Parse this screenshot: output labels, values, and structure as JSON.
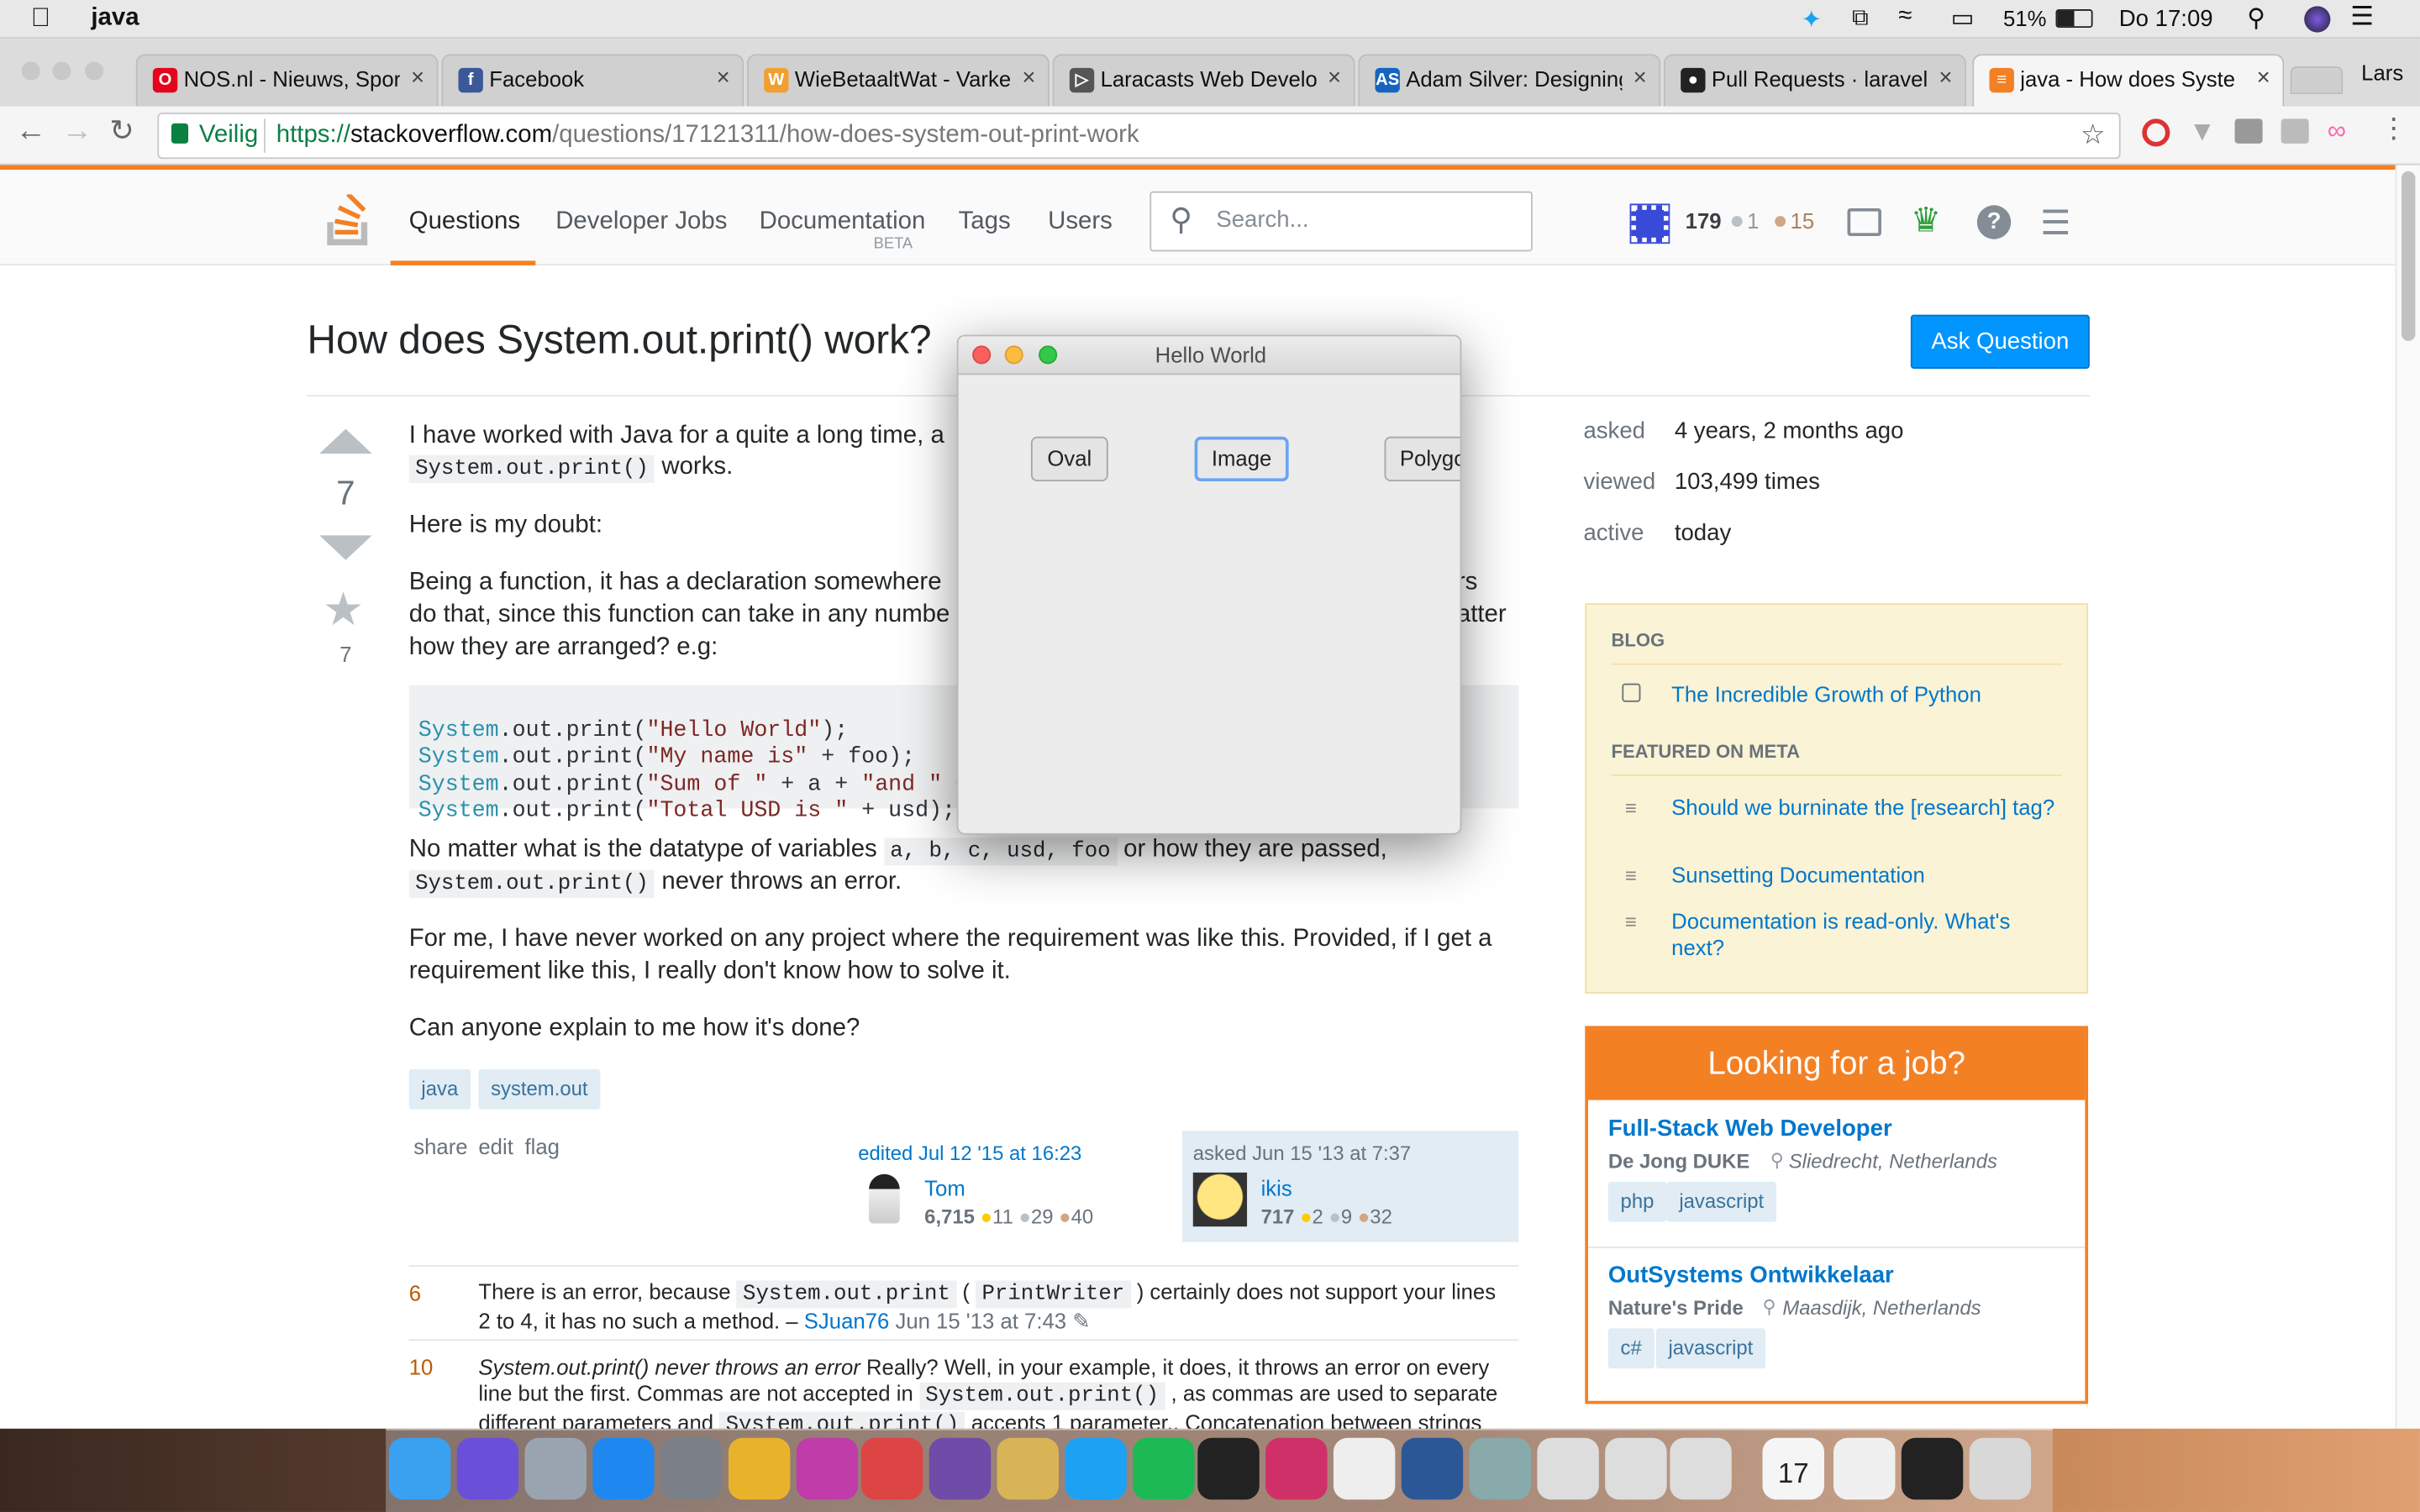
{
  "menubar": {
    "app": "java",
    "battery": "51%",
    "clock": "Do 17:09"
  },
  "tabs": [
    {
      "label": "NOS.nl - Nieuws, Spor",
      "fav": "O",
      "color": "#e4041c"
    },
    {
      "label": "Facebook",
      "fav": "f",
      "color": "#3b5998"
    },
    {
      "label": "WieBetaaltWat - Varke",
      "fav": "W",
      "color": "#f0a030"
    },
    {
      "label": "Laracasts Web Develo",
      "fav": "▷",
      "color": "#555"
    },
    {
      "label": "Adam Silver: Designing",
      "fav": "AS",
      "color": "#1565c0"
    },
    {
      "label": "Pull Requests · laravel/",
      "fav": "●",
      "color": "#222"
    },
    {
      "label": "java - How does Syste",
      "fav": "≡",
      "color": "#f48024"
    }
  ],
  "profile": "Lars",
  "address": {
    "secure": "Veilig",
    "scheme": "https://",
    "host": "stackoverflow.com",
    "path": "/questions/17121311/how-does-system-out-print-work"
  },
  "so": {
    "nav": {
      "questions": "Questions",
      "jobs": "Developer Jobs",
      "docs": "Documentation",
      "beta": "BETA",
      "tags": "Tags",
      "users": "Users"
    },
    "search_placeholder": "Search...",
    "rep": "179",
    "silver": "1",
    "bronze": "15"
  },
  "question": {
    "title": "How does System.out.print() work?",
    "ask_button": "Ask Question",
    "votes": "7",
    "favorites": "7",
    "p1a": "I have worked with Java for a quite a long time, a",
    "p1code": "System.out.print()",
    "p1b": " works.",
    "p2": "Here is my doubt:",
    "p3l1": "Being a function, it has a declaration somewhere",
    "p3l1end": "rs",
    "p3l2": "do that, since this function can take in any numbe",
    "p3l2end": "atter",
    "p3l3": "how they are arranged? e.g:",
    "code": [
      {
        "kw": "System",
        "rest": ".out.print(",
        "str": "\"Hello World\"",
        "tail": ");"
      },
      {
        "kw": "System",
        "rest": ".out.print(",
        "str": "\"My name is\"",
        "tail": " + foo);"
      },
      {
        "kw": "System",
        "rest": ".out.print(",
        "str": "\"Sum of \"",
        "tail": " + a + ",
        "str2": "\"and \"",
        "tail2": " +"
      },
      {
        "kw": "System",
        "rest": ".out.print(",
        "str": "\"Total USD is \"",
        "tail": " + usd);"
      }
    ],
    "p4a": "No matter what is the datatype of variables ",
    "p4code": "a, b, c, usd, foo",
    "p4b": " or how they are passed,",
    "p4code2": "System.out.print()",
    "p4c": " never throws an error.",
    "p5": "For me, I have never worked on any project where the requirement was like this. Provided, if I get a requirement like this, I really don't know how to solve it.",
    "p6": "Can anyone explain to me how it's done?",
    "tags": [
      "java",
      "system.out"
    ],
    "actions": [
      "share",
      "edit",
      "flag"
    ],
    "edited": {
      "label": "edited Jul 12 '15 at 16:23",
      "user": "Tom",
      "rep": "6,715",
      "gold": "11",
      "silver": "29",
      "bronze": "40"
    },
    "asked": {
      "label": "asked Jun 15 '13 at 7:37",
      "user": "ikis",
      "rep": "717",
      "gold": "2",
      "silver": "9",
      "bronze": "32"
    }
  },
  "comments": [
    {
      "score": "6",
      "a": "There is an error, because ",
      "c1": "System.out.print",
      "b": " ( ",
      "c2": "PrintWriter",
      "c": " ) certainly does not support your lines",
      "line2": "2 to 4, it has no such a method. – ",
      "user": "SJuan76",
      "date": " Jun 15 '13 at 7:43"
    },
    {
      "score": "10",
      "em": "System.out.print() never throws an error",
      "a": " Really? Well, in your example, it does, it throws an error on every",
      "line2a": "line but the first. Commas are not accepted in ",
      "c1": "System.out.print()",
      "line2b": " , as commas are used to separate",
      "line3a": "different parameters and ",
      "c2": "System.out.print()",
      "line3b": " accepts 1 parameter.. Concatenation between strings"
    }
  ],
  "stats": {
    "asked_label": "asked",
    "asked": "4 years, 2 months ago",
    "viewed_label": "viewed",
    "viewed": "103,499 times",
    "active_label": "active",
    "active": "today"
  },
  "blog": {
    "h1": "BLOG",
    "item": "The Incredible Growth of Python",
    "h2": "FEATURED ON META",
    "meta": [
      "Should we burninate the [research] tag?",
      "Sunsetting Documentation",
      "Documentation is read-only. What's next?"
    ]
  },
  "jobs": {
    "title": "Looking for a job?",
    "list": [
      {
        "title": "Full-Stack Web Developer",
        "company": "De Jong DUKE",
        "loc": "Sliedrecht, Netherlands",
        "tags": [
          "php",
          "javascript"
        ]
      },
      {
        "title": "OutSystems Ontwikkelaar",
        "company": "Nature's Pride",
        "loc": "Maasdijk, Netherlands",
        "tags": [
          "c#",
          "javascript"
        ]
      }
    ]
  },
  "dialog": {
    "title": "Hello World",
    "buttons": [
      "Oval",
      "Image",
      "Polygo"
    ]
  },
  "dock_calendar_day": "17"
}
